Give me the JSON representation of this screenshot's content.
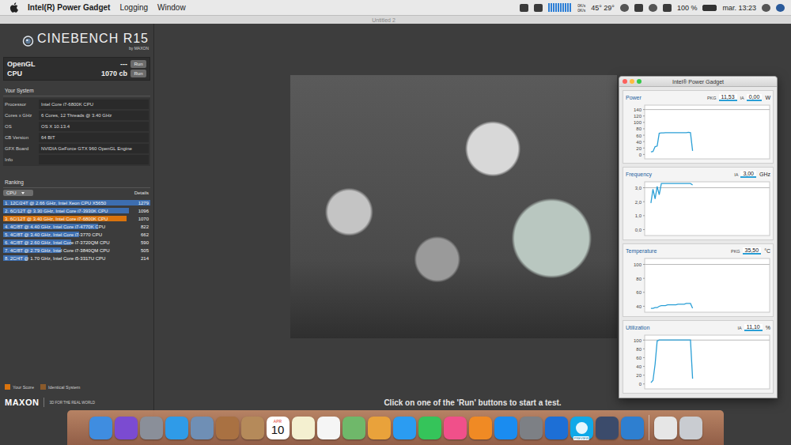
{
  "menu_bar": {
    "app": "Intel(R) Power Gadget",
    "menus": [
      "Logging",
      "Window"
    ],
    "status": {
      "net": [
        "0K/s",
        "0K/s"
      ],
      "temps": "45° 29°",
      "battery": "100 %",
      "clock": "mar. 13:23"
    }
  },
  "window": {
    "title": "Untitled 2"
  },
  "cinebench": {
    "logo": {
      "name": "CINEBENCH R15",
      "by": "by MAXON"
    },
    "tests": [
      {
        "name": "OpenGL",
        "score": "---",
        "button": "Run"
      },
      {
        "name": "CPU",
        "score": "1070 cb",
        "button": "Run"
      }
    ],
    "system": {
      "title": "Your System",
      "rows": [
        {
          "label": "Processor",
          "value": "Intel Core i7-6800K CPU"
        },
        {
          "label": "Cores x GHz",
          "value": "6 Cores, 12 Threads @ 3.40 GHz"
        },
        {
          "label": "OS",
          "value": "OS X 10.13.4"
        },
        {
          "label": "CB Version",
          "value": "64 BIT"
        },
        {
          "label": "GFX Board",
          "value": "NVIDIA GeForce GTX 960 OpenGL Engine"
        },
        {
          "label": "Info",
          "value": ""
        }
      ]
    },
    "ranking": {
      "title": "Ranking",
      "dropdown": "CPU",
      "details": "Details",
      "rows": [
        {
          "rank": "1.",
          "text": "12C/24T @ 2.66 GHz, Intel Xeon CPU X5650",
          "score": "1279",
          "level": 1.0,
          "selected": false
        },
        {
          "rank": "2.",
          "text": "6C/12T @ 3.30 GHz,  Intel Core i7-3930K CPU",
          "score": "1096",
          "level": 0.857,
          "selected": false
        },
        {
          "rank": "3.",
          "text": "6C/12T @ 3.40 GHz, Intel Core i7-6800K CPU",
          "score": "1070",
          "level": 0.837,
          "selected": true
        },
        {
          "rank": "4.",
          "text": "4C/8T @ 4.40 GHz, Intel Core i7-4770K CPU",
          "score": "822",
          "level": 0.643,
          "selected": false
        },
        {
          "rank": "5.",
          "text": "4C/8T @ 3.40 GHz,  Intel Core i7-3770 CPU",
          "score": "662",
          "level": 0.518,
          "selected": false
        },
        {
          "rank": "6.",
          "text": "4C/8T @ 2.60 GHz,  Intel Core i7-3720QM CPU",
          "score": "590",
          "level": 0.461,
          "selected": false
        },
        {
          "rank": "7.",
          "text": "4C/8T @ 2.79 GHz,  Intel Core i7-3840QM CPU",
          "score": "505",
          "level": 0.395,
          "selected": false
        },
        {
          "rank": "8.",
          "text": "2C/4T @ 1.70 GHz,  Intel Core i5-3317U CPU",
          "score": "214",
          "level": 0.167,
          "selected": false
        }
      ]
    },
    "legend": [
      {
        "label": "Your Score",
        "color": "#d9730d"
      },
      {
        "label": "Identical System",
        "color": "#8a5a2b"
      }
    ],
    "footer": {
      "brand": "MAXON",
      "tagline": "3D FOR THE REAL WORLD"
    },
    "caption": "Click on one of the 'Run' buttons to start a test."
  },
  "power_gadget": {
    "title": "Intel® Power Gadget",
    "charts": [
      {
        "title": "Power",
        "readouts": [
          {
            "label": "PKG",
            "value": "11,53"
          },
          {
            "label": "IA",
            "value": "0,00"
          }
        ],
        "unit": "W",
        "ticks": [
          "140",
          "120",
          "100",
          "80",
          "60",
          "40",
          "20",
          "0"
        ],
        "series": [
          8,
          9,
          24,
          26,
          66,
          67,
          67,
          68,
          68,
          68,
          68,
          68,
          68,
          68,
          68,
          68,
          68,
          68,
          69,
          68,
          11
        ]
      },
      {
        "title": "Frequency",
        "readouts": [
          {
            "label": "IA",
            "value": "3,00"
          }
        ],
        "unit": "GHz",
        "ticks": [
          "3,0",
          "2,0",
          "1,0",
          "0,0"
        ],
        "series": [
          1.9,
          2.9,
          2.2,
          3.1,
          2.5,
          3.3,
          3.3,
          3.3,
          3.3,
          3.3,
          3.3,
          3.3,
          3.3,
          3.3,
          3.3,
          3.3,
          3.3,
          3.3,
          3.3,
          3.3,
          3.2
        ]
      },
      {
        "title": "Temperature",
        "readouts": [
          {
            "label": "PKG",
            "value": "35,50"
          }
        ],
        "unit": "°C",
        "ticks": [
          "100",
          "80",
          "60",
          "40"
        ],
        "series": [
          37,
          37,
          38,
          38,
          40,
          41,
          41,
          41,
          42,
          42,
          42,
          42,
          42,
          43,
          43,
          43,
          43,
          44,
          44,
          44,
          37
        ]
      },
      {
        "title": "Utilization",
        "readouts": [
          {
            "label": "IA",
            "value": "11,10"
          }
        ],
        "unit": "%",
        "ticks": [
          "100",
          "80",
          "60",
          "40",
          "20",
          "0"
        ],
        "series": [
          3,
          8,
          45,
          98,
          100,
          100,
          100,
          100,
          100,
          100,
          100,
          100,
          100,
          100,
          100,
          100,
          100,
          100,
          100,
          100,
          12
        ]
      }
    ]
  },
  "dock": {
    "calendar": {
      "month": "APR",
      "day": "10"
    },
    "badge": "PREVIEW"
  }
}
